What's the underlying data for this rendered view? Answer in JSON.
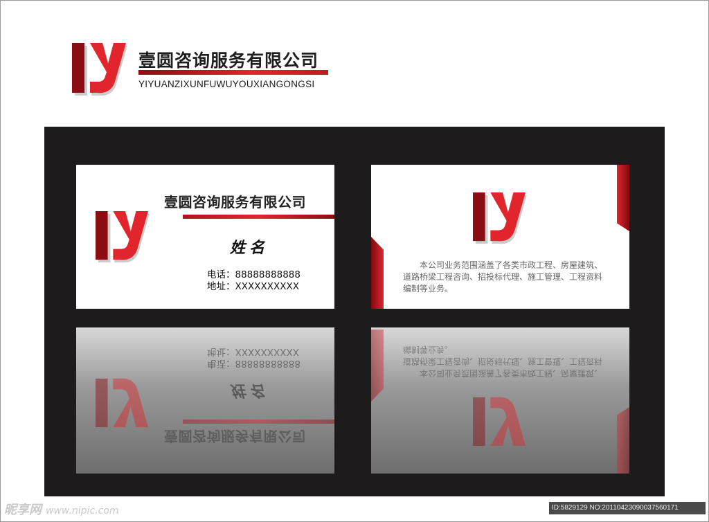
{
  "company": {
    "name": "壹圆咨询服务有限公司",
    "pinyin": "YIYUANZIXUNFUWUYOUXIANGONGSI"
  },
  "front_card": {
    "name": "姓名",
    "phone_line": "电话：88888888888",
    "address_line": "地址：XXXXXXXXXX"
  },
  "back_card": {
    "description": "本公司业务范围涵盖了各类市政工程、房屋建筑、道路桥梁工程咨询、招投标代理、施工管理、工程资料编制等业务。"
  },
  "watermark": {
    "site": "昵享网",
    "url": "www.nipic.com"
  },
  "image_id": "ID:5829129 NO:20110423090037560171",
  "colors": {
    "brand_red": "#e0262c",
    "dark_red": "#8a0d13",
    "stage": "#1d1b1b"
  }
}
